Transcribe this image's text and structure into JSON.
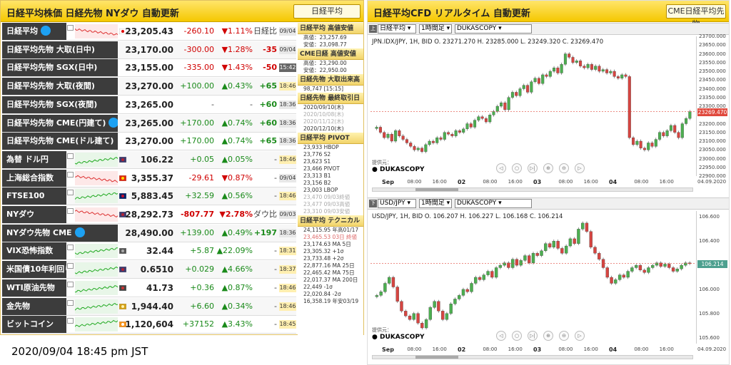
{
  "left": {
    "title": "日経平均株価 日経先物 NYダウ 自動更新",
    "button": "日経平均"
  },
  "rows": [
    {
      "label": "日経平均",
      "twitter": true,
      "value": "23,205.43",
      "change": "-260.10",
      "pct": "▼1.11%",
      "extra": "日経比",
      "time": "09/04",
      "dir": "dn",
      "hasMini": true,
      "flag": "jp"
    },
    {
      "label": "日経平均先物 大取(日中)",
      "value": "23,170.00",
      "change": "-300.00",
      "pct": "▼1.28%",
      "extra": "-35",
      "time": "09/04",
      "dir": "dn"
    },
    {
      "label": "日経平均先物 SGX(日中)",
      "value": "23,155.00",
      "change": "-335.00",
      "pct": "▼1.43%",
      "extra": "-50",
      "time": "15:42",
      "dir": "dn",
      "timeDark": true
    },
    {
      "label": "日経平均先物 大取(夜間)",
      "value": "23,270.00",
      "change": "+100.00",
      "pct": "▲0.43%",
      "extra": "+65",
      "time": "18:46",
      "dir": "up",
      "timeHl": true
    },
    {
      "label": "日経平均先物 SGX(夜間)",
      "value": "23,265.00",
      "change": "-",
      "pct": "-",
      "extra": "+60",
      "time": "18:36",
      "dir": "neu",
      "extraUp": true
    },
    {
      "label": "日経平均先物 CME(円建て)",
      "twitter": true,
      "value": "23,265.00",
      "change": "+170.00",
      "pct": "▲0.74%",
      "extra": "+60",
      "time": "18:36",
      "dir": "up"
    },
    {
      "label": "日経平均先物 CME(ドル建て)",
      "value": "23,270.00",
      "change": "+170.00",
      "pct": "▲0.74%",
      "extra": "+65",
      "time": "18:36",
      "dir": "up"
    },
    {
      "label": "為替 ドル円",
      "value": "106.22",
      "change": "+0.05",
      "pct": "▲0.05%",
      "extra": "-",
      "time": "18:46",
      "dir": "up",
      "hasMini": true,
      "flag": "us",
      "timeHl": true
    },
    {
      "label": "上海総合指数",
      "value": "3,355.37",
      "change": "-29.61",
      "pct": "▼0.87%",
      "extra": "-",
      "time": "09/04",
      "dir": "dn",
      "hasMini": true,
      "flag": "cn"
    },
    {
      "label": "FTSE100",
      "value": "5,883.45",
      "change": "+32.59",
      "pct": "▲0.56%",
      "extra": "-",
      "time": "18:46",
      "dir": "up",
      "hasMini": true,
      "flag": "uk",
      "timeHl": true
    },
    {
      "label": "NYダウ",
      "value": "28,292.73",
      "change": "-807.77",
      "pct": "▼2.78%",
      "extra": "ダウ比",
      "time": "09/03",
      "dir": "dn",
      "hasMini": true,
      "flag": "us",
      "boldChg": true
    },
    {
      "label": "NYダウ先物 CME",
      "twitter": true,
      "value": "28,490.00",
      "change": "+139.00",
      "pct": "▲0.49%",
      "extra": "+197",
      "time": "18:36",
      "dir": "up"
    },
    {
      "label": "VIX恐怖指数",
      "value": "32.44",
      "change": "+5.87",
      "pct": "▲22.09%",
      "extra": "-",
      "time": "18:31",
      "dir": "up",
      "hasMini": true,
      "flag": "vix",
      "timeHl": true
    },
    {
      "label": "米国債10年利回り",
      "value": "0.6510",
      "change": "+0.029",
      "pct": "▲4.66%",
      "extra": "-",
      "time": "18:37",
      "dir": "up",
      "hasMini": true,
      "flag": "us",
      "timeHl": true
    },
    {
      "label": "WTI原油先物",
      "value": "41.73",
      "change": "+0.36",
      "pct": "▲0.87%",
      "extra": "-",
      "time": "18:46",
      "dir": "up",
      "hasMini": true,
      "flag": "oil",
      "timeHl": true
    },
    {
      "label": "金先物",
      "value": "1,944.40",
      "change": "+6.60",
      "pct": "▲0.34%",
      "extra": "-",
      "time": "18:46",
      "dir": "up",
      "hasMini": true,
      "flag": "gold",
      "timeHl": true
    },
    {
      "label": "ビットコイン",
      "value": "1,120,604",
      "change": "+37152",
      "pct": "▲3.43%",
      "extra": "-",
      "time": "18:45",
      "dir": "up",
      "hasMini": true,
      "flag": "btc",
      "timeHl": true
    }
  ],
  "side": {
    "sections": [
      {
        "title": "日経平均 高値安値",
        "lines": [
          {
            "t": "高値：23,257.69"
          },
          {
            "t": "安値：23,098.77"
          }
        ]
      },
      {
        "title": "CME日経 高値安値",
        "lines": [
          {
            "t": "高値：23,290.00"
          },
          {
            "t": "安値：22,950.00"
          }
        ]
      },
      {
        "title": "日経先物 大取出来高",
        "lines": [
          {
            "t": "98,747 [15:15]"
          }
        ]
      },
      {
        "title": "日経先物 最終取引日",
        "lines": [
          {
            "t": "2020/09/10(木)"
          },
          {
            "t": "2020/10/08(木)",
            "c": "gray"
          },
          {
            "t": "2020/11/12(木)",
            "c": "gray"
          },
          {
            "t": "2020/12/10(木)"
          }
        ]
      },
      {
        "title": "日経平均 PIVOT",
        "lines": [
          {
            "t": "23,933 HBOP"
          },
          {
            "t": "23,776 S2"
          },
          {
            "t": "23,623 S1"
          },
          {
            "t": "23,466 PIVOT"
          },
          {
            "t": "23,313 B1"
          },
          {
            "t": "23,156 B2"
          },
          {
            "t": "23,003 LBOP"
          },
          {
            "t": "23,470 09/03終値",
            "c": "gray"
          },
          {
            "t": "23,477 09/03高値",
            "c": "gray"
          },
          {
            "t": "23,310 09/03安値",
            "c": "gray"
          }
        ]
      },
      {
        "title": "日経平均 テクニカル",
        "lines": [
          {
            "t": "24,115.95 年高01/17"
          },
          {
            "t": "23,465.53 03日 終値",
            "c": "red"
          },
          {
            "t": "23,174.63 MA 5日"
          },
          {
            "t": "23,305.32 +1σ"
          },
          {
            "t": "23,733.48 +2σ"
          },
          {
            "t": "22,877.16 MA 25日"
          },
          {
            "t": "22,465.42 MA 75日"
          },
          {
            "t": "22,017.37 MA 200日"
          },
          {
            "t": "22,449 -1σ"
          },
          {
            "t": "22,020.84 -2σ"
          },
          {
            "t": "16,358.19 年安03/19"
          }
        ]
      }
    ]
  },
  "timestamp": "2020/09/04 18:45 pm JST",
  "right": {
    "title": "日経平均CFD リアルタイム 自動更新",
    "button": "CME日経平均先物"
  },
  "chart_data": [
    {
      "type": "candlestick",
      "toolbar": {
        "badge": "上",
        "symbol": "日経平均",
        "interval": "1時間足",
        "source": "DUKASCOPY"
      },
      "quote": "JPN.IDX/JPY, 1H, BID   O. 23271.270 H. 23285.000 L. 23249.320 C. 23269.470",
      "last_price": "23269.470",
      "yticks": [
        "23700.000",
        "23650.000",
        "23600.000",
        "23550.000",
        "23500.000",
        "23450.000",
        "23400.000",
        "23350.000",
        "23300.000",
        "23250.000",
        "23200.000",
        "23150.000",
        "23100.000",
        "23050.000",
        "23000.000",
        "22950.000",
        "22900.000"
      ],
      "ylim": [
        22900,
        23700
      ],
      "xticks": [
        {
          "t": "Sep",
          "b": true
        },
        {
          "t": "08:00"
        },
        {
          "t": "16:00"
        },
        {
          "t": "02",
          "b": true
        },
        {
          "t": "08:00"
        },
        {
          "t": "16:00"
        },
        {
          "t": "03",
          "b": true
        },
        {
          "t": "08:00"
        },
        {
          "t": "16:00"
        },
        {
          "t": "04",
          "b": true
        },
        {
          "t": "08:00"
        },
        {
          "t": "16:00"
        },
        {
          "t": "04.09.2020"
        }
      ],
      "close": [
        23180,
        23150,
        23120,
        23140,
        23100,
        23160,
        23130,
        23110,
        23090,
        23070,
        23050,
        23060,
        23040,
        23080,
        23100,
        23090,
        23120,
        23110,
        23150,
        23140,
        23130,
        23160,
        23150,
        23170,
        23200,
        23180,
        23220,
        23240,
        23230,
        23210,
        23250,
        23270,
        23300,
        23320,
        23280,
        23350,
        23380,
        23360,
        23400,
        23420,
        23380,
        23440,
        23460,
        23430,
        23480,
        23470,
        23500,
        23520,
        23490,
        23540,
        23600,
        23580,
        23550,
        23560,
        23530,
        23520,
        23540,
        23510,
        23530,
        23500,
        23510,
        23490,
        23500,
        23470,
        23460,
        23480,
        23470,
        23120,
        23080,
        23100,
        23060,
        23050,
        23090,
        23070,
        23110,
        23150,
        23130,
        23160,
        23190,
        23150,
        23120,
        23200,
        23230,
        23269
      ],
      "copyright": "提供元：",
      "brand": "DUKASCOPY"
    },
    {
      "type": "candlestick",
      "toolbar": {
        "badge": "下",
        "symbol": "USD/JPY",
        "interval": "1時間足",
        "source": "DUKASCOPY"
      },
      "quote": "USD/JPY, 1H, BID   O. 106.207 H. 106.227 L. 106.168 C. 106.214",
      "last_price": "106.214",
      "yticks": [
        "106.600",
        "106.400",
        "106.200",
        "106.000",
        "105.800",
        "105.600"
      ],
      "ylim": [
        105.55,
        106.65
      ],
      "xticks": [
        {
          "t": "Sep",
          "b": true
        },
        {
          "t": "08:00"
        },
        {
          "t": "16:00"
        },
        {
          "t": "02",
          "b": true
        },
        {
          "t": "08:00"
        },
        {
          "t": "16:00"
        },
        {
          "t": "03",
          "b": true
        },
        {
          "t": "08:00"
        },
        {
          "t": "16:00"
        },
        {
          "t": "04",
          "b": true
        },
        {
          "t": "08:00"
        },
        {
          "t": "16:00"
        },
        {
          "t": "04.09.2020"
        }
      ],
      "close": [
        105.95,
        105.98,
        106.05,
        106.1,
        106.02,
        105.9,
        105.82,
        105.78,
        105.75,
        105.8,
        105.72,
        105.68,
        105.75,
        105.85,
        105.9,
        105.82,
        105.75,
        105.8,
        105.88,
        105.92,
        105.95,
        106.0,
        105.98,
        106.05,
        106.1,
        106.08,
        106.12,
        106.15,
        106.1,
        106.18,
        106.2,
        106.22,
        106.18,
        106.25,
        106.2,
        106.24,
        106.28,
        106.22,
        106.3,
        106.28,
        106.32,
        106.38,
        106.35,
        106.4,
        106.34,
        106.3,
        106.36,
        106.42,
        106.38,
        106.5,
        106.55,
        106.48,
        106.35,
        106.3,
        106.25,
        106.18,
        106.1,
        106.05,
        106.08,
        106.12,
        106.1,
        106.15,
        106.18,
        106.2,
        106.16,
        106.14,
        106.18,
        106.2,
        106.22,
        106.19,
        106.21,
        106.18,
        106.15,
        106.17,
        106.2,
        106.22,
        106.214
      ],
      "copyright": "提供元：",
      "brand": "DUKASCOPY"
    }
  ]
}
